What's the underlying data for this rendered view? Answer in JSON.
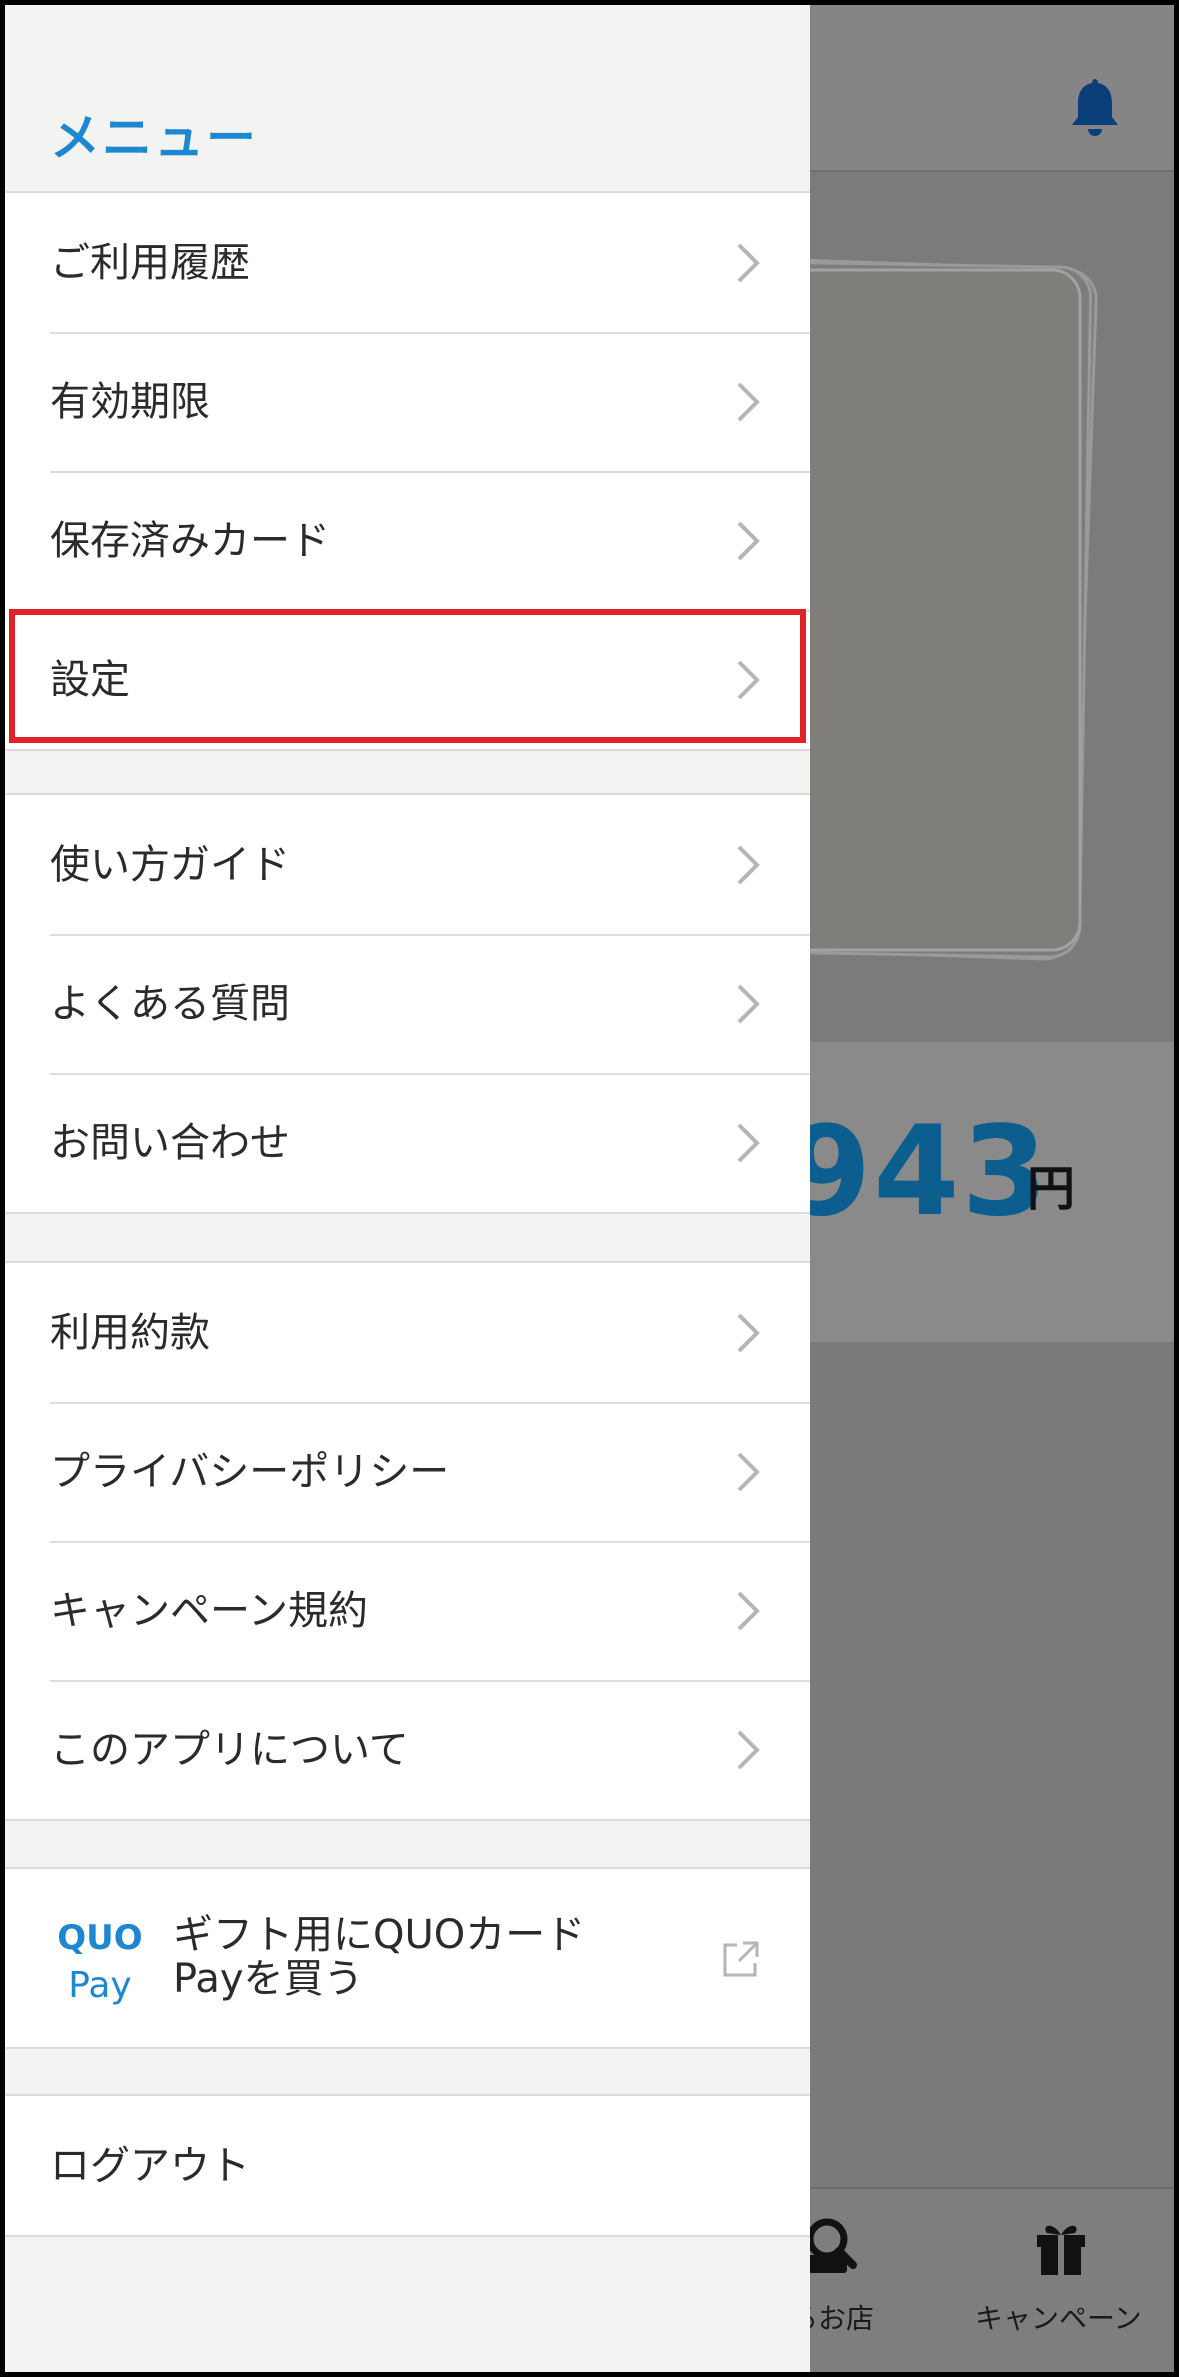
{
  "background_app": {
    "balance_value": "943",
    "balance_unit": "円",
    "tab_bar": {
      "shop_label": "るお店",
      "shop_icon": "quo-search-icon",
      "campaign_label": "キャンペーン",
      "campaign_icon": "gift-icon"
    },
    "header_icon": "bell-icon"
  },
  "drawer": {
    "title": "メニュー",
    "groups": [
      {
        "items": [
          {
            "label": "ご利用履歴"
          },
          {
            "label": "有効期限"
          },
          {
            "label": "保存済みカード"
          },
          {
            "label": "設定",
            "highlighted": true
          }
        ]
      },
      {
        "items": [
          {
            "label": "使い方ガイド"
          },
          {
            "label": "よくある質問"
          },
          {
            "label": "お問い合わせ"
          }
        ]
      },
      {
        "items": [
          {
            "label": "利用約款"
          },
          {
            "label": "プライバシーポリシー"
          },
          {
            "label": "キャンペーン規約"
          },
          {
            "label": "このアプリについて"
          }
        ]
      }
    ],
    "quo_link": {
      "logo_text_top": "QUO",
      "logo_text_bottom": "Pay",
      "label": "ギフト用にQUOカードPayを買う",
      "icon": "external-link-icon"
    },
    "logout": {
      "label": "ログアウト"
    }
  },
  "colors": {
    "accent_blue": "#1d88d1",
    "highlight_red": "#e0232b",
    "balance_blue": "#0b5e8e"
  }
}
